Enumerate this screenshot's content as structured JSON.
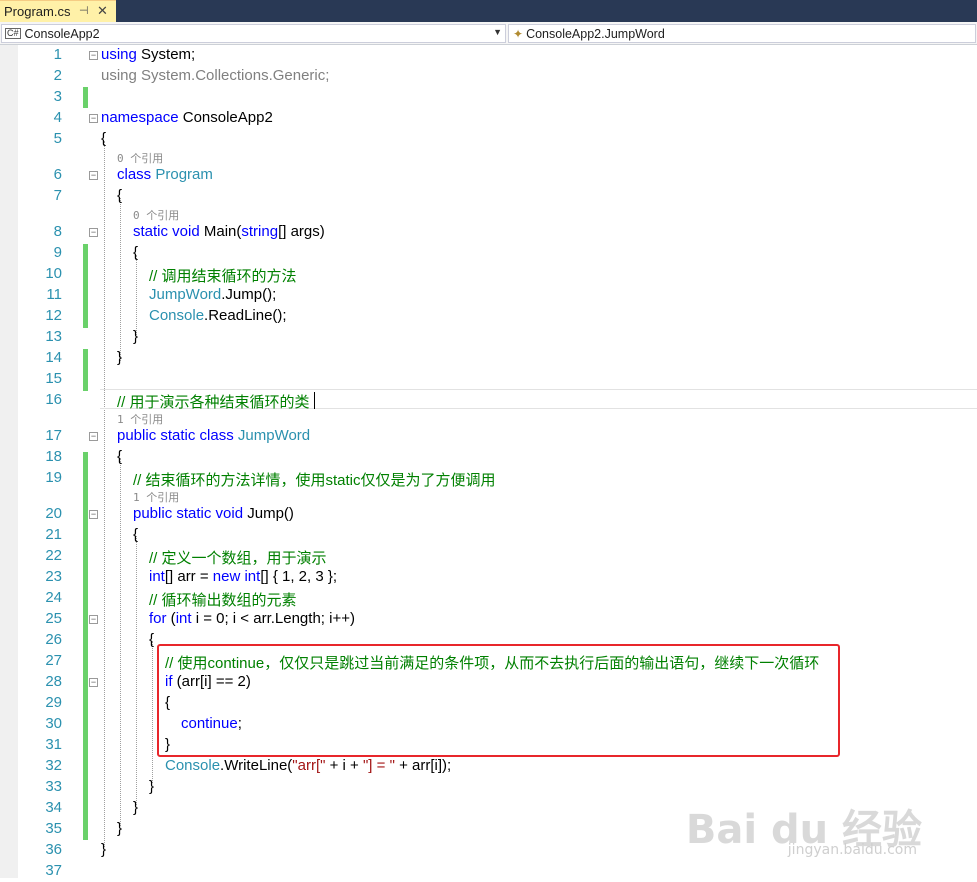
{
  "tab": {
    "title": "Program.cs",
    "pin_icon": "pin-icon",
    "close_icon": "close-icon"
  },
  "nav": {
    "project": "ConsoleApp2",
    "member": "ConsoleApp2.JumpWord"
  },
  "codelens": {
    "l6": "0 个引用",
    "l8": "0 个引用",
    "l17": "1 个引用",
    "l20": "1 个引用"
  },
  "lines": [
    "1",
    "2",
    "3",
    "4",
    "5",
    "6",
    "7",
    "8",
    "9",
    "10",
    "11",
    "12",
    "13",
    "14",
    "15",
    "16",
    "17",
    "18",
    "19",
    "20",
    "21",
    "22",
    "23",
    "24",
    "25",
    "26",
    "27",
    "28",
    "29",
    "30",
    "31",
    "32",
    "33",
    "34",
    "35",
    "36",
    "37"
  ],
  "code": {
    "l1_kw": "using",
    "l1_rest": " System;",
    "l2_kw": "using",
    "l2_rest": " System.Collections.Generic;",
    "l4_kw": "namespace",
    "l4_rest": " ConsoleApp2",
    "l5": "{",
    "l6_kw": "class",
    "l6_ty": " Program",
    "l7": "{",
    "l8_kw": "static void",
    "l8_a": " Main(",
    "l8_kw2": "string",
    "l8_b": "[] args)",
    "l9": "{",
    "l10": "// 调用结束循环的方法",
    "l11_ty": "JumpWord",
    "l11_rest": ".Jump();",
    "l12_ty": "Console",
    "l12_rest": ".ReadLine();",
    "l13": "}",
    "l14": "}",
    "l16": "// 用于演示各种结束循环的类",
    "l17_kw": "public static class",
    "l17_ty": " JumpWord",
    "l18": "{",
    "l19": "// 结束循环的方法详情，使用static仅仅是为了方便调用",
    "l20_kw": "public static void",
    "l20_rest": " Jump()",
    "l21": "{",
    "l22": "// 定义一个数组，用于演示",
    "l23_kw": "int",
    "l23_a": "[] arr = ",
    "l23_kw2": "new int",
    "l23_b": "[] { 1, 2, 3 };",
    "l24": "// 循环输出数组的元素",
    "l25_kw": "for",
    "l25_a": " (",
    "l25_kw2": "int",
    "l25_b": " i = 0; i < arr.Length; i++)",
    "l26": "{",
    "l27": "// 使用continue，仅仅只是跳过当前满足的条件项，从而不去执行后面的输出语句，继续下一次循环",
    "l28_kw": "if",
    "l28_rest": " (arr[i] == 2)",
    "l29": "{",
    "l30_kw": "continue",
    "l30_rest": ";",
    "l31": "}",
    "l32_ty": "Console",
    "l32_a": ".WriteLine(",
    "l32_s1": "\"arr[\"",
    "l32_b": " + i + ",
    "l32_s2": "\"] = \"",
    "l32_c": " + arr[i]);",
    "l33": "}",
    "l34": "}",
    "l35": "}",
    "l36": "}"
  },
  "watermark": {
    "brand": "Bai du 经验",
    "url": "jingyan.baidu.com"
  },
  "colors": {
    "keyword": "#0000ff",
    "type": "#2b91af",
    "comment": "#008000",
    "string": "#a31515",
    "highlight": "#e8262b",
    "change_bar": "#6ad16a"
  }
}
